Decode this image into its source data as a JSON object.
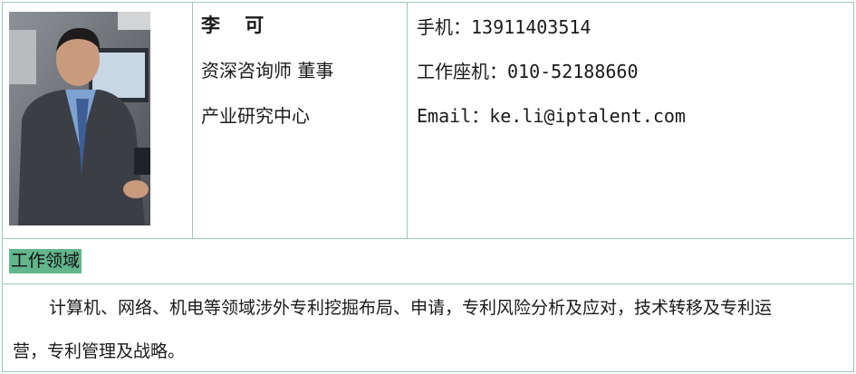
{
  "profile": {
    "name": "李 可",
    "position": "资深咨询师 董事",
    "department": "产业研究中心"
  },
  "contact": {
    "mobile_label": "手机：",
    "mobile": "13911403514",
    "office_label": "工作座机：",
    "office": "010-52188660",
    "email_label": "Email：",
    "email": "ke.li@iptalent.com"
  },
  "section": {
    "label": "工作领域",
    "description_line1": "计算机、网络、机电等领域涉外专利挖掘布局、申请，专利风险分析及应对，技术转移及专利运",
    "description_line2": "营，专利管理及战略。"
  },
  "colors": {
    "border": "#9cc9b4",
    "section_highlight": "#62b68c"
  }
}
